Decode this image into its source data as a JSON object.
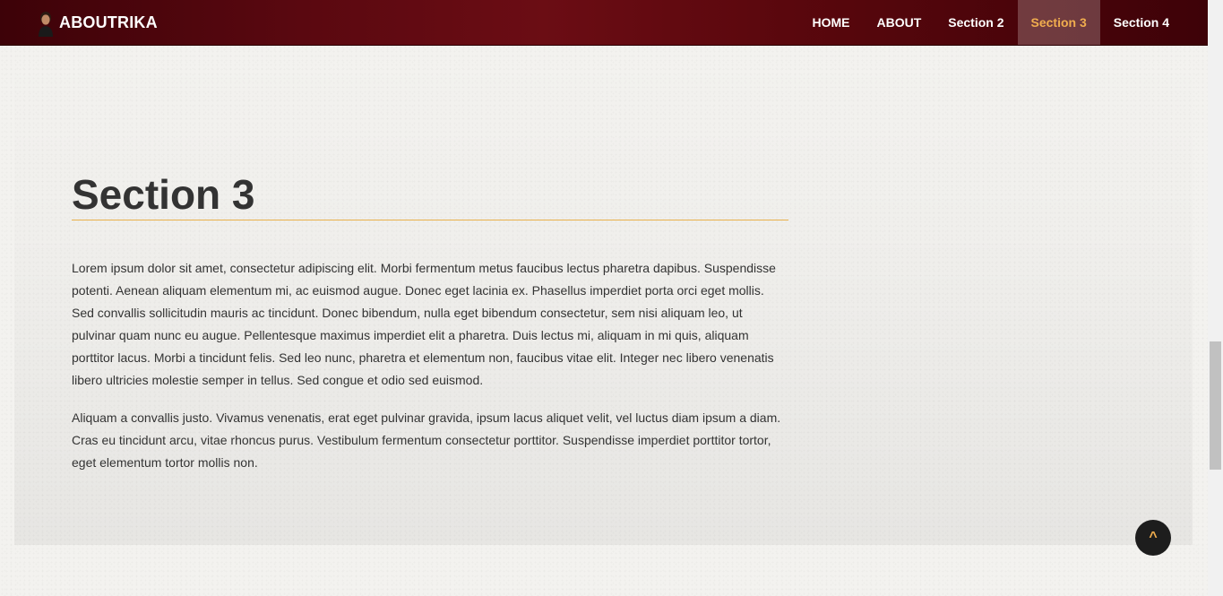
{
  "brand": {
    "name": "ABOUTRIKA",
    "avatar_icon": "player-avatar-icon"
  },
  "nav": {
    "items": [
      {
        "label": "HOME",
        "active": false
      },
      {
        "label": "ABOUT",
        "active": false
      },
      {
        "label": "Section 2",
        "active": false
      },
      {
        "label": "Section 3",
        "active": true
      },
      {
        "label": "Section 4",
        "active": false
      }
    ]
  },
  "section": {
    "title": "Section 3",
    "paragraphs": [
      "Lorem ipsum dolor sit amet, consectetur adipiscing elit. Morbi fermentum metus faucibus lectus pharetra dapibus. Suspendisse potenti. Aenean aliquam elementum mi, ac euismod augue. Donec eget lacinia ex. Phasellus imperdiet porta orci eget mollis. Sed convallis sollicitudin mauris ac tincidunt. Donec bibendum, nulla eget bibendum consectetur, sem nisi aliquam leo, ut pulvinar quam nunc eu augue. Pellentesque maximus imperdiet elit a pharetra. Duis lectus mi, aliquam in mi quis, aliquam porttitor lacus. Morbi a tincidunt felis. Sed leo nunc, pharetra et elementum non, faucibus vitae elit. Integer nec libero venenatis libero ultricies molestie semper in tellus. Sed congue et odio sed euismod.",
      "Aliquam a convallis justo. Vivamus venenatis, erat eget pulvinar gravida, ipsum lacus aliquet velit, vel luctus diam ipsum a diam. Cras eu tincidunt arcu, vitae rhoncus purus. Vestibulum fermentum consectetur porttitor. Suspendisse imperdiet porttitor tortor, eget elementum tortor mollis non."
    ]
  },
  "back_to_top": {
    "label": "^"
  },
  "colors": {
    "navbar": "#5a0810",
    "accent": "#f0ad4e",
    "text": "#333333"
  }
}
